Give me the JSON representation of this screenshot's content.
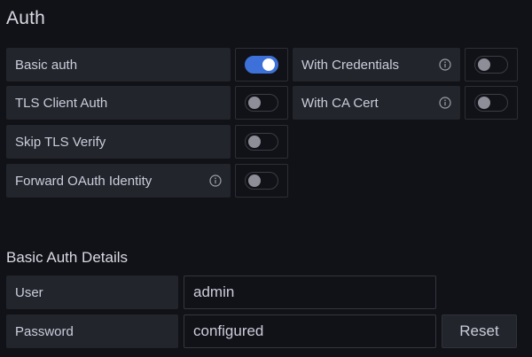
{
  "auth": {
    "title": "Auth",
    "basic_auth": {
      "label": "Basic auth",
      "enabled": true
    },
    "with_credentials": {
      "label": "With Credentials",
      "enabled": false,
      "icon": "info-icon"
    },
    "tls_client_auth": {
      "label": "TLS Client Auth",
      "enabled": false
    },
    "with_ca_cert": {
      "label": "With CA Cert",
      "enabled": false,
      "icon": "info-icon"
    },
    "skip_tls_verify": {
      "label": "Skip TLS Verify",
      "enabled": false
    },
    "forward_oauth": {
      "label": "Forward OAuth Identity",
      "enabled": false,
      "icon": "info-icon"
    }
  },
  "basic_auth_details": {
    "title": "Basic Auth Details",
    "user": {
      "label": "User",
      "value": "admin"
    },
    "password": {
      "label": "Password",
      "value": "configured",
      "reset_label": "Reset"
    }
  },
  "colors": {
    "background": "#111217",
    "label_bg": "#22252b",
    "toggle_on": "#3d71d9",
    "toggle_off_knob": "#8e8e98",
    "text": "#ccccdc"
  }
}
